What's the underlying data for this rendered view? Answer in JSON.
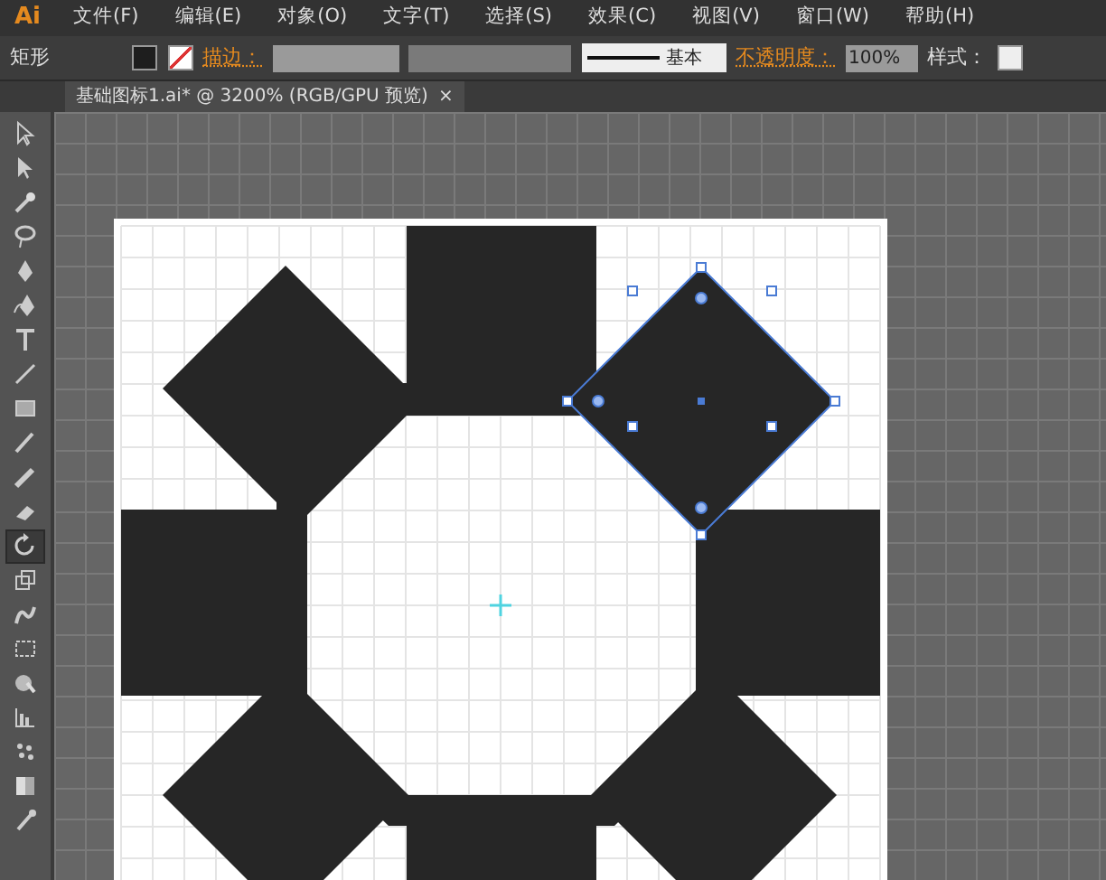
{
  "app_logo": "Ai",
  "menu": [
    "文件(F)",
    "编辑(E)",
    "对象(O)",
    "文字(T)",
    "选择(S)",
    "效果(C)",
    "视图(V)",
    "窗口(W)",
    "帮助(H)"
  ],
  "control_bar": {
    "tool_name": "矩形",
    "stroke_label": "描边：",
    "stroke_profile": "基本",
    "opacity_label": "不透明度：",
    "opacity_value": "100%",
    "style_label": "样式："
  },
  "document_tab": {
    "title": "基础图标1.ai* @ 3200% (RGB/GPU 预览)",
    "close": "×"
  },
  "tools": [
    {
      "kind": "select",
      "selected": false
    },
    {
      "kind": "direct",
      "selected": false
    },
    {
      "kind": "wand",
      "selected": false
    },
    {
      "kind": "lasso",
      "selected": false
    },
    {
      "kind": "pen",
      "selected": false
    },
    {
      "kind": "curvature",
      "selected": false
    },
    {
      "kind": "type",
      "selected": false
    },
    {
      "kind": "line",
      "selected": false
    },
    {
      "kind": "rect",
      "selected": false
    },
    {
      "kind": "brush",
      "selected": false
    },
    {
      "kind": "pencil",
      "selected": false
    },
    {
      "kind": "eraser",
      "selected": false
    },
    {
      "kind": "rotate",
      "selected": true
    },
    {
      "kind": "scale",
      "selected": false
    },
    {
      "kind": "warp",
      "selected": false
    },
    {
      "kind": "freetransform",
      "selected": false
    },
    {
      "kind": "shapebuilder",
      "selected": false
    },
    {
      "kind": "chart",
      "selected": false
    },
    {
      "kind": "symbol",
      "selected": false
    },
    {
      "kind": "gradient",
      "selected": false
    },
    {
      "kind": "eyedropper",
      "selected": false
    }
  ]
}
